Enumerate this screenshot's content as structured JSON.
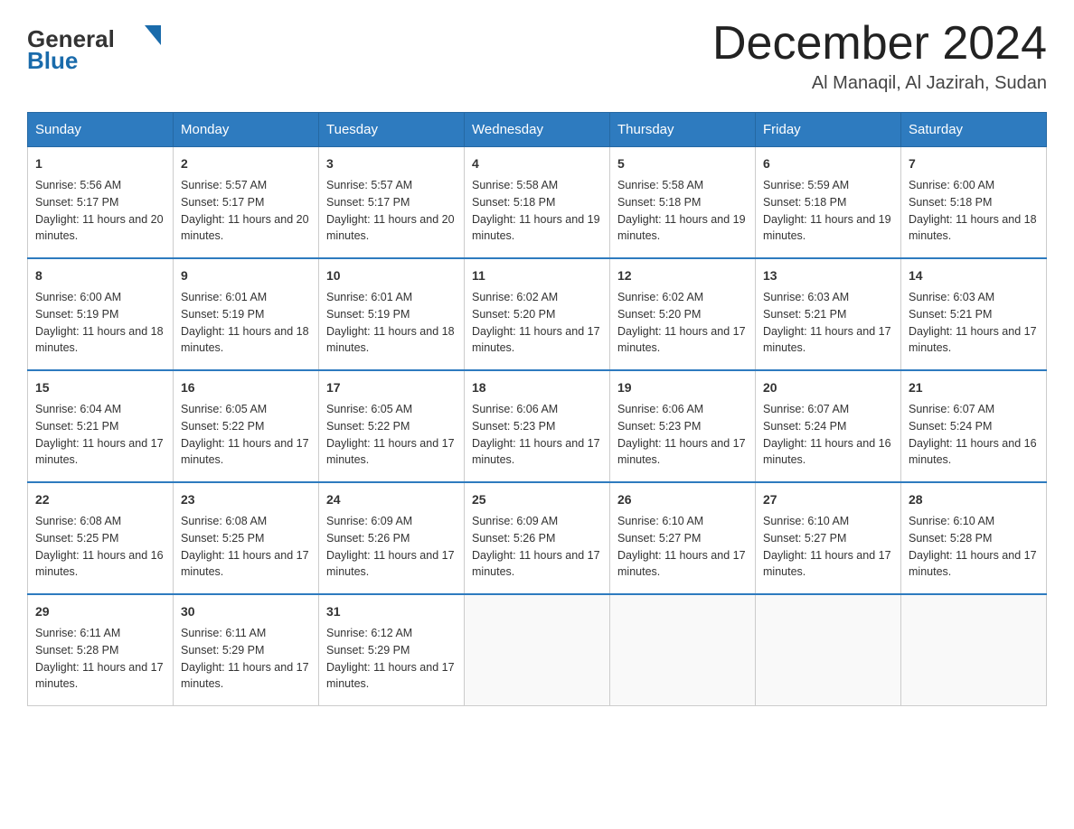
{
  "header": {
    "logo_general": "General",
    "logo_blue": "Blue",
    "month_title": "December 2024",
    "subtitle": "Al Manaqil, Al Jazirah, Sudan"
  },
  "days_of_week": [
    "Sunday",
    "Monday",
    "Tuesday",
    "Wednesday",
    "Thursday",
    "Friday",
    "Saturday"
  ],
  "weeks": [
    [
      {
        "day": "1",
        "sunrise": "5:56 AM",
        "sunset": "5:17 PM",
        "daylight": "11 hours and 20 minutes."
      },
      {
        "day": "2",
        "sunrise": "5:57 AM",
        "sunset": "5:17 PM",
        "daylight": "11 hours and 20 minutes."
      },
      {
        "day": "3",
        "sunrise": "5:57 AM",
        "sunset": "5:17 PM",
        "daylight": "11 hours and 20 minutes."
      },
      {
        "day": "4",
        "sunrise": "5:58 AM",
        "sunset": "5:18 PM",
        "daylight": "11 hours and 19 minutes."
      },
      {
        "day": "5",
        "sunrise": "5:58 AM",
        "sunset": "5:18 PM",
        "daylight": "11 hours and 19 minutes."
      },
      {
        "day": "6",
        "sunrise": "5:59 AM",
        "sunset": "5:18 PM",
        "daylight": "11 hours and 19 minutes."
      },
      {
        "day": "7",
        "sunrise": "6:00 AM",
        "sunset": "5:18 PM",
        "daylight": "11 hours and 18 minutes."
      }
    ],
    [
      {
        "day": "8",
        "sunrise": "6:00 AM",
        "sunset": "5:19 PM",
        "daylight": "11 hours and 18 minutes."
      },
      {
        "day": "9",
        "sunrise": "6:01 AM",
        "sunset": "5:19 PM",
        "daylight": "11 hours and 18 minutes."
      },
      {
        "day": "10",
        "sunrise": "6:01 AM",
        "sunset": "5:19 PM",
        "daylight": "11 hours and 18 minutes."
      },
      {
        "day": "11",
        "sunrise": "6:02 AM",
        "sunset": "5:20 PM",
        "daylight": "11 hours and 17 minutes."
      },
      {
        "day": "12",
        "sunrise": "6:02 AM",
        "sunset": "5:20 PM",
        "daylight": "11 hours and 17 minutes."
      },
      {
        "day": "13",
        "sunrise": "6:03 AM",
        "sunset": "5:21 PM",
        "daylight": "11 hours and 17 minutes."
      },
      {
        "day": "14",
        "sunrise": "6:03 AM",
        "sunset": "5:21 PM",
        "daylight": "11 hours and 17 minutes."
      }
    ],
    [
      {
        "day": "15",
        "sunrise": "6:04 AM",
        "sunset": "5:21 PM",
        "daylight": "11 hours and 17 minutes."
      },
      {
        "day": "16",
        "sunrise": "6:05 AM",
        "sunset": "5:22 PM",
        "daylight": "11 hours and 17 minutes."
      },
      {
        "day": "17",
        "sunrise": "6:05 AM",
        "sunset": "5:22 PM",
        "daylight": "11 hours and 17 minutes."
      },
      {
        "day": "18",
        "sunrise": "6:06 AM",
        "sunset": "5:23 PM",
        "daylight": "11 hours and 17 minutes."
      },
      {
        "day": "19",
        "sunrise": "6:06 AM",
        "sunset": "5:23 PM",
        "daylight": "11 hours and 17 minutes."
      },
      {
        "day": "20",
        "sunrise": "6:07 AM",
        "sunset": "5:24 PM",
        "daylight": "11 hours and 16 minutes."
      },
      {
        "day": "21",
        "sunrise": "6:07 AM",
        "sunset": "5:24 PM",
        "daylight": "11 hours and 16 minutes."
      }
    ],
    [
      {
        "day": "22",
        "sunrise": "6:08 AM",
        "sunset": "5:25 PM",
        "daylight": "11 hours and 16 minutes."
      },
      {
        "day": "23",
        "sunrise": "6:08 AM",
        "sunset": "5:25 PM",
        "daylight": "11 hours and 17 minutes."
      },
      {
        "day": "24",
        "sunrise": "6:09 AM",
        "sunset": "5:26 PM",
        "daylight": "11 hours and 17 minutes."
      },
      {
        "day": "25",
        "sunrise": "6:09 AM",
        "sunset": "5:26 PM",
        "daylight": "11 hours and 17 minutes."
      },
      {
        "day": "26",
        "sunrise": "6:10 AM",
        "sunset": "5:27 PM",
        "daylight": "11 hours and 17 minutes."
      },
      {
        "day": "27",
        "sunrise": "6:10 AM",
        "sunset": "5:27 PM",
        "daylight": "11 hours and 17 minutes."
      },
      {
        "day": "28",
        "sunrise": "6:10 AM",
        "sunset": "5:28 PM",
        "daylight": "11 hours and 17 minutes."
      }
    ],
    [
      {
        "day": "29",
        "sunrise": "6:11 AM",
        "sunset": "5:28 PM",
        "daylight": "11 hours and 17 minutes."
      },
      {
        "day": "30",
        "sunrise": "6:11 AM",
        "sunset": "5:29 PM",
        "daylight": "11 hours and 17 minutes."
      },
      {
        "day": "31",
        "sunrise": "6:12 AM",
        "sunset": "5:29 PM",
        "daylight": "11 hours and 17 minutes."
      },
      null,
      null,
      null,
      null
    ]
  ],
  "labels": {
    "sunrise": "Sunrise:",
    "sunset": "Sunset:",
    "daylight": "Daylight:"
  }
}
